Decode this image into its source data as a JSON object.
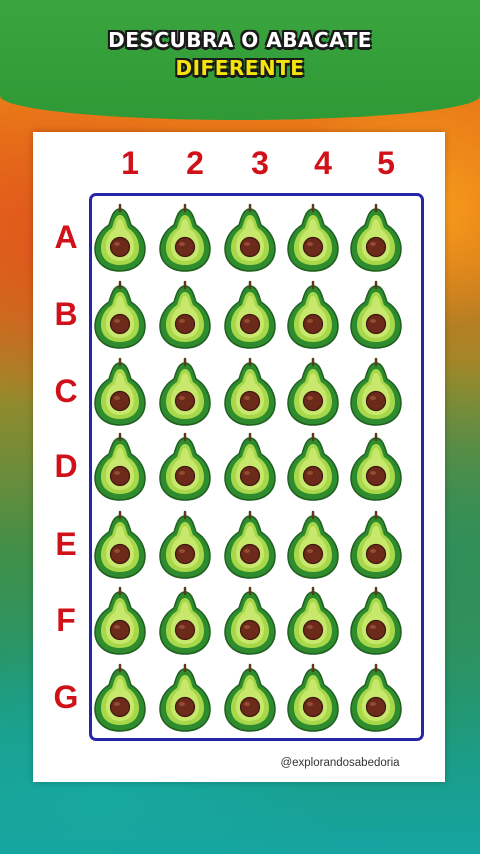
{
  "title_line1": "DESCUBRA O ABACATE",
  "title_line2": "DIFERENTE",
  "columns": [
    "1",
    "2",
    "3",
    "4",
    "5"
  ],
  "rows": [
    "A",
    "B",
    "C",
    "D",
    "E",
    "F",
    "G"
  ],
  "watermark": "@explorandosabedoria",
  "colors": {
    "header_green": "#2f9a35",
    "label_red": "#d1111a",
    "grid_border": "#2626a6",
    "title_yellow": "#f5e40a",
    "avocado_skin": "#2e8b2e",
    "avocado_flesh": "#a6d84a",
    "seed": "#6b2a1a"
  },
  "grid_icon": "avocado-icon"
}
